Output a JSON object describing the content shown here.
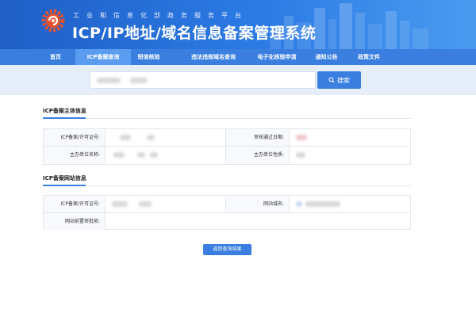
{
  "header": {
    "subtitle": "工业和信息化部政务服务平台",
    "title": "ICP/IP地址/域名信息备案管理系统"
  },
  "nav": {
    "items": [
      {
        "label": "首页",
        "active": false
      },
      {
        "label": "ICP备案查询",
        "active": true
      },
      {
        "label": "短信核验",
        "active": false
      },
      {
        "label": "违法违规域名查询",
        "active": false
      },
      {
        "label": "电子化核验申请",
        "active": false
      },
      {
        "label": "通知公告",
        "active": false
      },
      {
        "label": "政策文件",
        "active": false
      }
    ]
  },
  "search": {
    "button_label": "搜索",
    "button_icon": "search-icon"
  },
  "sections": {
    "entity": {
      "title": "ICP备案主体信息",
      "fields": {
        "license_no_label": "ICP备案/许可证号:",
        "approve_date_label": "审核通过日期:",
        "org_name_label": "主办单位名称:",
        "org_type_label": "主办单位性质:"
      }
    },
    "website": {
      "title": "ICP备案网站信息",
      "fields": {
        "license_no_label": "ICP备案/许可证号:",
        "domain_label": "网站域名:",
        "preapproval_label": "网站前置审批项:"
      }
    }
  },
  "actions": {
    "return_label": "返回查询结果"
  },
  "colors": {
    "primary": "#3a7fe0",
    "banner_dark": "#1f5fc6",
    "search_band": "#e6eef9"
  }
}
